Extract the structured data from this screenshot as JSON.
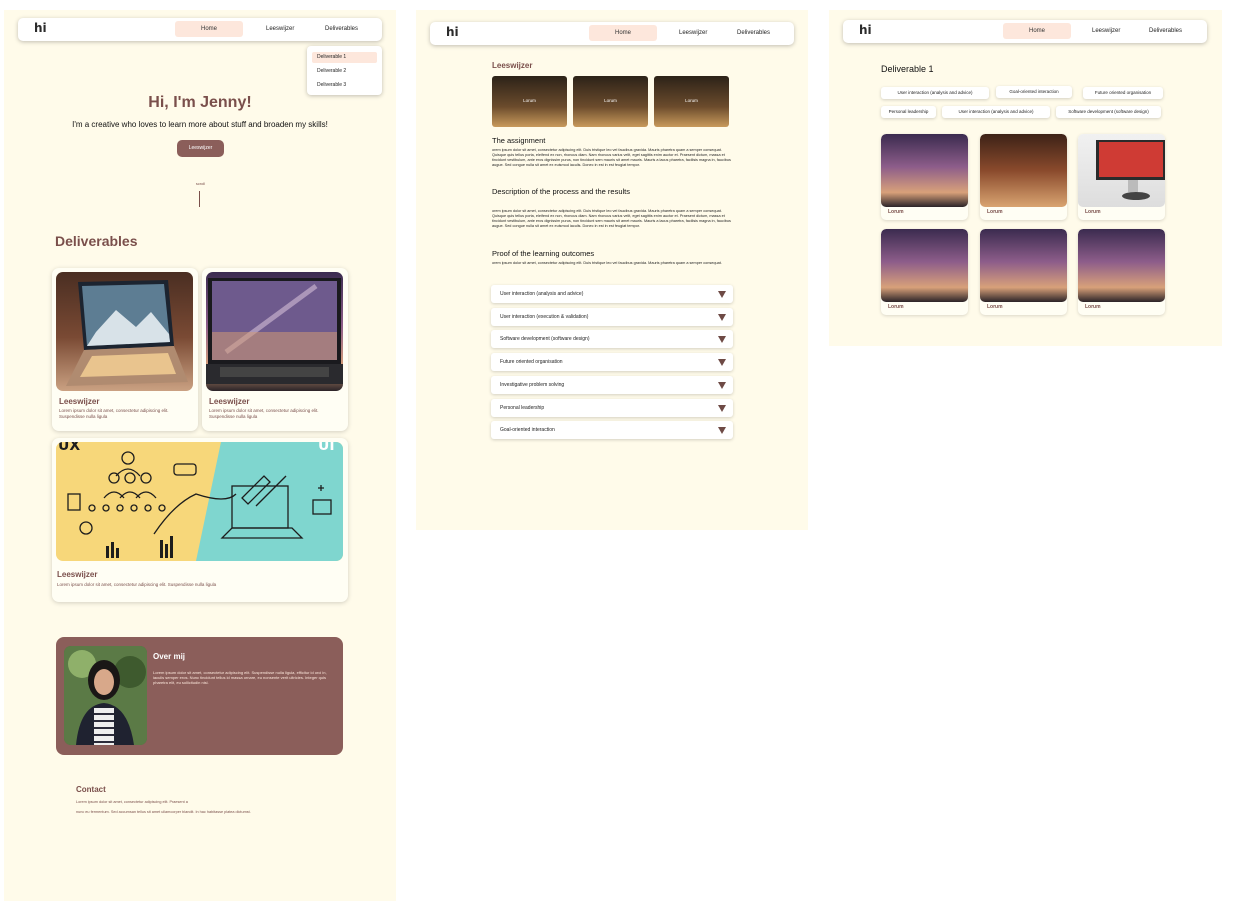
{
  "nav": {
    "logo": "hi",
    "home": "Home",
    "leeswijzer": "Leeswijzer",
    "deliverables": "Deliverables"
  },
  "dropdown": [
    "Deliverable 1",
    "Deliverable 2",
    "Deliverable 3"
  ],
  "hero": {
    "title": "Hi, I'm Jenny!",
    "subtitle": "I'm a creative who loves to learn more about stuff and broaden my skills!",
    "button": "Leeswijzer",
    "scroll": "scroll"
  },
  "deliverables": {
    "title": "Deliverables",
    "cards": [
      {
        "title": "Leeswijzer",
        "text": "Lorem ipsum dolor sit amet, consectetur adipiscing elit. Suspendisse nulla ligula"
      },
      {
        "title": "Leeswijzer",
        "text": "Lorem ipsum dolor sit amet, consectetur adipiscing elit. Suspendisse nulla ligula"
      },
      {
        "title": "Leeswijzer",
        "text": "Lorem ipsum dolor sit amet, consectetur adipiscing elit. Suspendisse nulla ligula"
      }
    ],
    "banner_left": "UX",
    "banner_right": "UI"
  },
  "about": {
    "title": "Over mij",
    "text": "Lorem ipsum dolor sit amet, consectetur adipiscing elit. Suspendisse nulla ligula, efficitur id orci in, iaculis semper eros. Nunc tincidunt tellus id massa ornare, eu nonsente verit ultricies. Integer quis pharetra elit, eu sollicitudin nisl."
  },
  "contact": {
    "title": "Contact",
    "line1": "Lorem ipsum dolor sit amet, consectetur adipiscing elit. Praesent a",
    "line2": "nunc eu fermentum. Sed accumsan tellus sit amet ullamcorper blandit. In hac habitasse platea dictumst."
  },
  "leeswijzer_page": {
    "title": "Leeswijzer",
    "thumbs": [
      "Lorum",
      "Lorum",
      "Lorum"
    ],
    "assignment_title": "The assignment",
    "assignment_text": "orem ipsum dolor sit amet, consectetur adipiscing elit. Duis tristique leo vel faucibus gravida. Mauris pharetra quam a semper consequat. Quisque quis tellus porta, eleifend ex non, rhoncus diam. Nam rhoncus varius velit, eget sagittis enim auctor et. Praesent dictum, massa et tincidunt vestibulum, ante eros dignissim purus, non tincidunt sem mauris sit amet mauris. Mauris a lacus pharetra, facilisis magna in, faucibus augue. Sed congue nulla sit amet ex euismod iaculis. Donec in est in est feugiat tempor.",
    "process_title": "Description of the process and the results",
    "process_text": "orem ipsum dolor sit amet, consectetur adipiscing elit. Duis tristique leo vel faucibus gravida. Mauris pharetra quam a semper consequat. Quisque quis tellus porta, eleifend ex non, rhoncus diam. Nam rhoncus varius velit, eget sagittis enim auctor et. Praesent dictum, massa et tincidunt vestibulum, ante eros dignissim purus, non tincidunt sem mauris sit amet mauris. Mauris a lacus pharetra, facilisis magna in, faucibus augue. Sed congue nulla sit amet ex euismod iaculis. Donec in est in est feugiat tempor.",
    "proof_title": "Proof of the learning outcomes",
    "proof_text": "orem ipsum dolor sit amet, consectetur adipiscing elit. Duis tristique leo vel faucibus gravida. Mauris pharetra quam a semper consequat.",
    "accordion": [
      "User interaction (analysis and advice)",
      "User interaction (execution & validation)",
      "Software development (software design)",
      "Future oriented organisation",
      "Investigative problem solving",
      "Personal leadership",
      "Goal-oriented interaction"
    ]
  },
  "deliverable_page": {
    "title": "Deliverable 1",
    "tags": [
      "User interaction (analysis and advice)",
      "Goal-oriented interaction",
      "Future oriented organisation",
      "Personal leadership",
      "User interaction (analysis and advice)",
      "Software development (software design)"
    ],
    "gallery": [
      "Lorum",
      "Lorum",
      "Lorum",
      "Lorum",
      "Lorum",
      "Lorum"
    ]
  }
}
